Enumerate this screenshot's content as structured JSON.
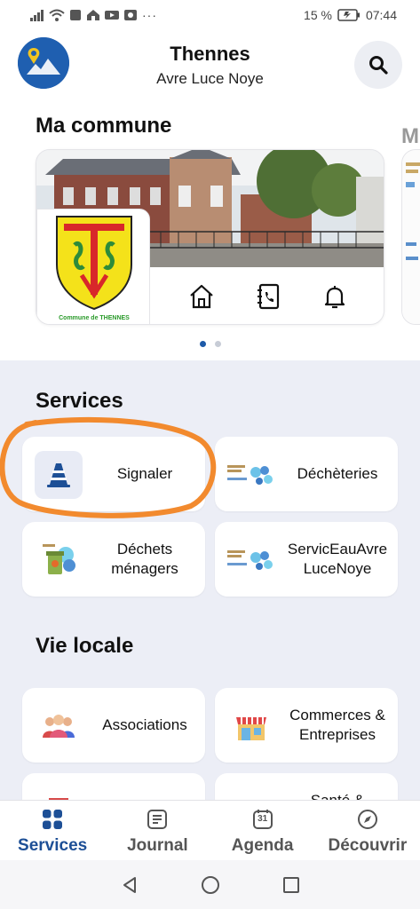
{
  "status_bar": {
    "battery": "15 %",
    "time": "07:44"
  },
  "header": {
    "title": "Thennes",
    "subtitle": "Avre Luce Noye"
  },
  "commune": {
    "title": "Ma commune",
    "coat_label": "Commune de THENNES",
    "next_title": "M",
    "carousel_dots": 2,
    "active_dot": 0
  },
  "services": {
    "title": "Services",
    "tiles": [
      {
        "label": "Signaler",
        "icon": "traffic-cone-icon"
      },
      {
        "label": "Déchèteries",
        "icon": "dechetteries-logo"
      },
      {
        "label": "Déchets ménagers",
        "icon": "dechets-menagers-logo"
      },
      {
        "label": "ServicEauAvre LuceNoye",
        "icon": "service-eau-logo"
      }
    ]
  },
  "vie_locale": {
    "title": "Vie locale",
    "tiles": [
      {
        "label": "Associations",
        "icon": "people-icon"
      },
      {
        "label": "Commerces & Entreprises",
        "icon": "shop-icon"
      },
      {
        "label": "",
        "icon": "partial-icon"
      },
      {
        "label": "Santé &",
        "icon": "partial-icon"
      }
    ]
  },
  "tabbar": {
    "tabs": [
      {
        "label": "Services",
        "icon": "grid-icon",
        "active": true
      },
      {
        "label": "Journal",
        "icon": "journal-icon",
        "active": false
      },
      {
        "label": "Agenda",
        "icon": "calendar-icon",
        "calendar_number": "31",
        "active": false
      },
      {
        "label": "Découvrir",
        "icon": "compass-icon",
        "active": false
      }
    ]
  },
  "colors": {
    "brand": "#1d4f96",
    "highlight": "#f28a2e",
    "background": "#eceef6"
  }
}
